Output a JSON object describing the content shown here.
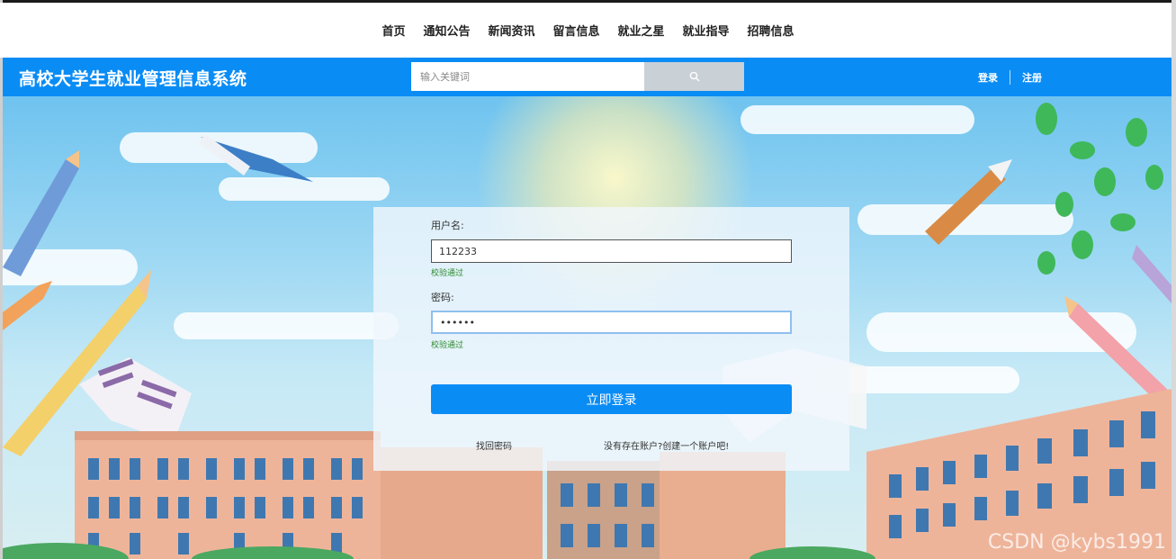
{
  "nav": {
    "items": [
      "首页",
      "通知公告",
      "新闻资讯",
      "留言信息",
      "就业之星",
      "就业指导",
      "招聘信息"
    ]
  },
  "header": {
    "title": "高校大学生就业管理信息系统",
    "search_placeholder": "输入关键词",
    "search_icon": "search-icon",
    "login_link": "登录",
    "register_link": "注册"
  },
  "login_form": {
    "username_label": "用户名:",
    "username_value": "112233",
    "username_validation": "校验通过",
    "password_label": "密码:",
    "password_value": "••••••",
    "password_validation": "校验通过",
    "submit_label": "立即登录",
    "forgot_link": "找回密码",
    "register_link": "没有存在账户?创建一个账户吧!"
  },
  "watermark": "CSDN @kybs1991",
  "colors": {
    "accent": "#0a8cf5",
    "validation": "#2e8b2e"
  }
}
